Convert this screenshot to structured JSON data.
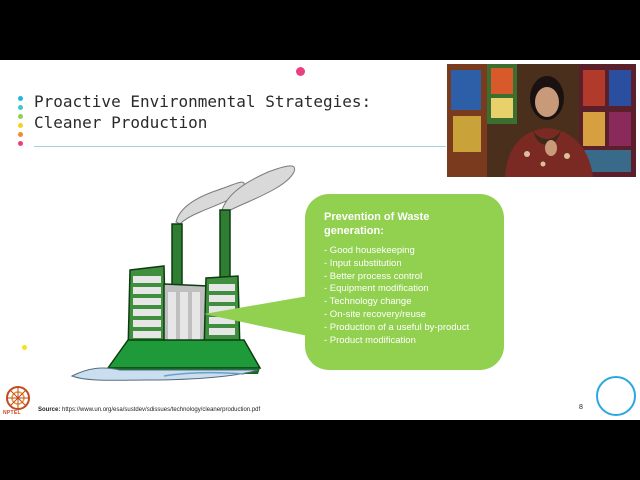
{
  "slide": {
    "title_line1": "Proactive Environmental Strategies:",
    "title_line2": "Cleaner Production",
    "page_number": "8"
  },
  "bubble": {
    "heading_line1": "Prevention of Waste",
    "heading_line2": "generation:",
    "items": [
      "- Good housekeeping",
      "- Input substitution",
      "- Better process control",
      "- Equipment modification",
      "- Technology change",
      "- On-site recovery/reuse",
      "- Production of a useful by-product",
      "- Product modification"
    ]
  },
  "source": {
    "label": "Source:",
    "url": "https://www.un.org/esa/sustdev/sdissues/technology/cleanerproduction.pdf"
  },
  "logo": {
    "text": "NPTEL"
  },
  "icons": {
    "factory": "factory-illustration-icon",
    "logo": "nptel-logo-icon",
    "nav": "navigation-ring-icon"
  },
  "colors": {
    "bubble": "#92d050",
    "title_rule": "#9fd3e0",
    "nav_ring": "#29a8e0",
    "accent_dots": [
      "#1fb6e8",
      "#3ec6d6",
      "#8fd14f",
      "#f5d21c",
      "#f08c2e",
      "#e8417f"
    ]
  }
}
